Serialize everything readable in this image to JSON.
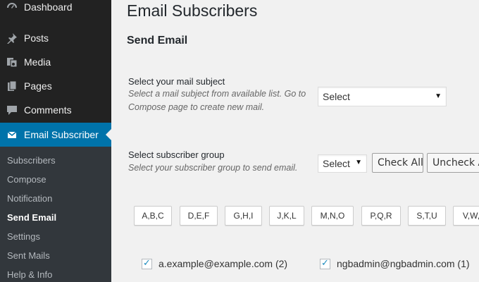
{
  "sidebar": {
    "items": [
      {
        "label": "Dashboard",
        "icon": "dashboard-icon"
      },
      {
        "label": "Posts",
        "icon": "pin-icon"
      },
      {
        "label": "Media",
        "icon": "media-icon"
      },
      {
        "label": "Pages",
        "icon": "pages-icon"
      },
      {
        "label": "Comments",
        "icon": "comment-icon"
      },
      {
        "label": "Email Subscriber",
        "icon": "envelope-icon",
        "active": true
      }
    ],
    "submenu": [
      {
        "label": "Subscribers"
      },
      {
        "label": "Compose"
      },
      {
        "label": "Notification"
      },
      {
        "label": "Send Email",
        "current": true
      },
      {
        "label": "Settings"
      },
      {
        "label": "Sent Mails"
      },
      {
        "label": "Help & Info"
      }
    ],
    "colors": {
      "bg": "#222222",
      "active": "#0073aa",
      "submenu_bg": "#32373c"
    }
  },
  "page": {
    "title": "Email Subscribers",
    "section": "Send Email"
  },
  "mail_subject": {
    "label": "Select your mail subject",
    "description": "Select a mail subject from available list. Go to Compose page to create new mail.",
    "select_value": "Select"
  },
  "subscriber_group": {
    "label": "Select subscriber group",
    "description": "Select your subscriber group to send email.",
    "select_value": "Select",
    "check_all": "Check All",
    "uncheck_all": "Uncheck All"
  },
  "letter_filters": [
    "A,B,C",
    "D,E,F",
    "G,H,I",
    "J,K,L",
    "M,N,O",
    "P,Q,R",
    "S,T,U",
    "V,W,X"
  ],
  "subscribers": [
    {
      "email": "a.example@example.com (2)",
      "checked": true
    },
    {
      "email": "ngbadmin@ngbadmin.com (1)",
      "checked": true
    }
  ]
}
